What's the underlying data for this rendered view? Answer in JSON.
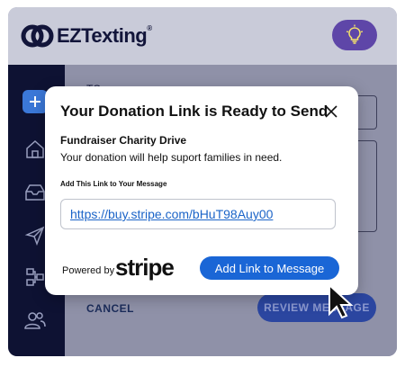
{
  "app": {
    "logo_text": "EZTexting",
    "logo_reg": "®"
  },
  "compose": {
    "to_label": "TO",
    "cancel_label": "CANCEL",
    "review_label": "REVIEW MESSAGE"
  },
  "modal": {
    "title": "Your Donation Link is Ready to Send",
    "campaign_name": "Fundraiser Charity Drive",
    "campaign_description": "Your donation will help suport families in need.",
    "link_label": "Add This Link to Your Message",
    "link_url": "https://buy.stripe.com/bHuT98Auy00",
    "powered_by": "Powered by",
    "stripe_logo": "stripe",
    "add_button_label": "Add Link to Message"
  },
  "colors": {
    "brand_navy": "#0e1233",
    "primary_button": "#1a66d6",
    "link": "#1b64c8",
    "idea_button": "#5e46a8"
  },
  "icons": [
    "lightbulb-icon",
    "plus-icon",
    "home-icon",
    "inbox-icon",
    "send-icon",
    "workflow-icon",
    "contacts-icon",
    "close-icon",
    "mouse-cursor-icon"
  ]
}
